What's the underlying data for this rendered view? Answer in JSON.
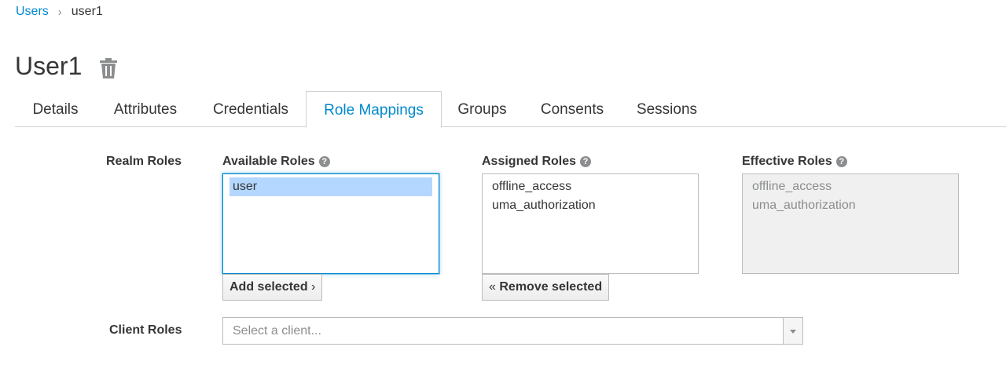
{
  "breadcrumb": {
    "parent": "Users",
    "separator": "›",
    "current": "user1"
  },
  "page": {
    "title": "User1",
    "delete_icon": "trash-icon"
  },
  "tabs": [
    {
      "label": "Details"
    },
    {
      "label": "Attributes"
    },
    {
      "label": "Credentials"
    },
    {
      "label": "Role Mappings",
      "active": true
    },
    {
      "label": "Groups"
    },
    {
      "label": "Consents"
    },
    {
      "label": "Sessions"
    }
  ],
  "realm_roles": {
    "label": "Realm Roles",
    "available": {
      "label": "Available Roles",
      "options": [
        "user"
      ],
      "selected": "user"
    },
    "assigned": {
      "label": "Assigned Roles",
      "options": [
        "offline_access",
        "uma_authorization"
      ]
    },
    "effective": {
      "label": "Effective Roles",
      "options": [
        "offline_access",
        "uma_authorization"
      ]
    },
    "add_button": "Add selected",
    "add_glyph": "›",
    "remove_button": "Remove selected",
    "remove_glyph": "«"
  },
  "client_roles": {
    "label": "Client Roles",
    "placeholder": "Select a client..."
  },
  "colors": {
    "link": "#0088ce",
    "text": "#363636",
    "selection": "#b3d7ff",
    "muted": "#8b8d8f"
  }
}
